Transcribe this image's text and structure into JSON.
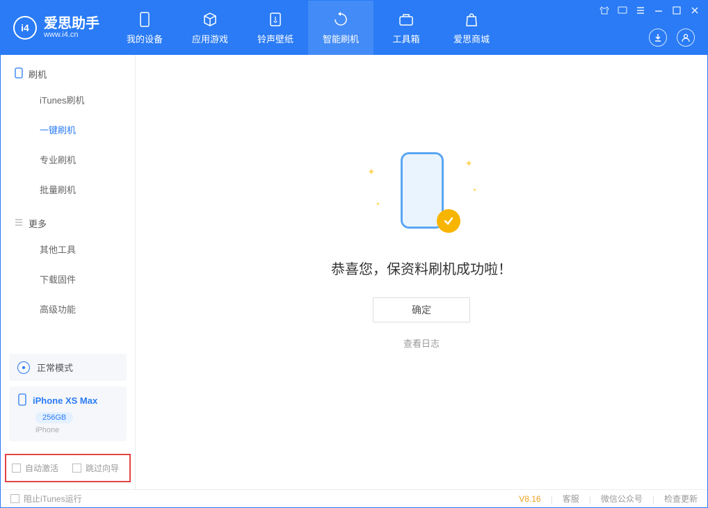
{
  "app": {
    "name": "爱思助手",
    "url": "www.i4.cn"
  },
  "nav": {
    "items": [
      {
        "label": "我的设备"
      },
      {
        "label": "应用游戏"
      },
      {
        "label": "铃声壁纸"
      },
      {
        "label": "智能刷机"
      },
      {
        "label": "工具箱"
      },
      {
        "label": "爱思商城"
      }
    ]
  },
  "sidebar": {
    "section1": {
      "title": "刷机",
      "items": [
        "iTunes刷机",
        "一键刷机",
        "专业刷机",
        "批量刷机"
      ]
    },
    "section2": {
      "title": "更多",
      "items": [
        "其他工具",
        "下载固件",
        "高级功能"
      ]
    }
  },
  "mode": {
    "label": "正常模式"
  },
  "device": {
    "name": "iPhone XS Max",
    "storage": "256GB",
    "type": "iPhone"
  },
  "checkboxes": {
    "auto_activate": "自动激活",
    "skip_guide": "跳过向导"
  },
  "main": {
    "success_text": "恭喜您，保资料刷机成功啦！",
    "confirm_label": "确定",
    "log_link": "查看日志"
  },
  "footer": {
    "block_itunes": "阻止iTunes运行",
    "version": "V8.16",
    "support": "客服",
    "wechat": "微信公众号",
    "update": "检查更新"
  }
}
